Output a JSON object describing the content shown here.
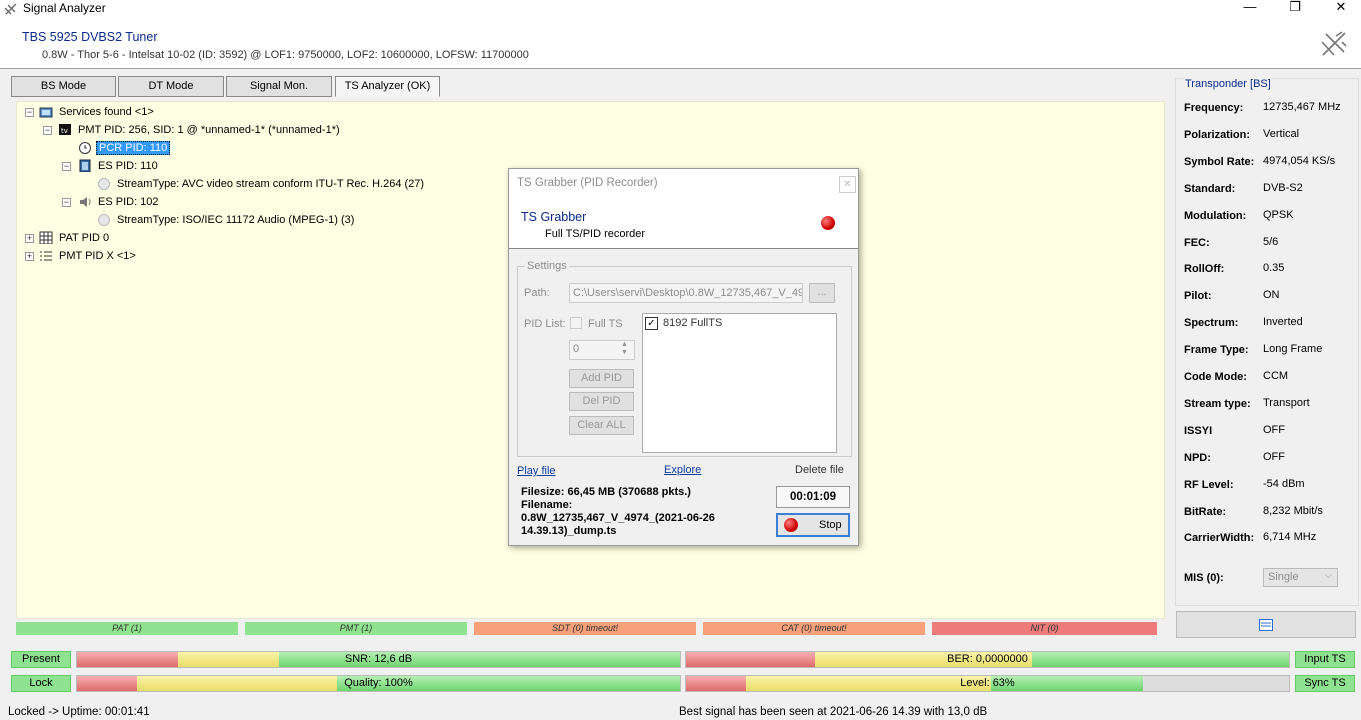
{
  "window": {
    "title": "Signal Analyzer",
    "min": "—",
    "max": "❐",
    "close": "✕"
  },
  "header": {
    "device": "TBS 5925 DVBS2 Tuner",
    "info": "0.8W - Thor 5-6 - Intelsat 10-02 (ID: 3592) @ LOF1: 9750000, LOF2: 10600000, LOFSW: 11700000"
  },
  "tabs": [
    "BS Mode",
    "DT Mode",
    "Signal Mon.",
    "TS Analyzer (OK)"
  ],
  "tree": {
    "services": "Services found <1>",
    "pmt": "PMT PID: 256, SID: 1 @ *unnamed-1* (*unnamed-1*)",
    "pcr": "PCR PID: 110",
    "es1": "ES PID: 110",
    "es1_type": "StreamType: AVC video stream conform ITU-T Rec. H.264 (27)",
    "es2": "ES PID: 102",
    "es2_type": "StreamType: ISO/IEC 11172 Audio (MPEG-1) (3)",
    "pat": "PAT PID 0",
    "pmtx": "PMT PID X <1>"
  },
  "dialog": {
    "title": "TS Grabber (PID Recorder)",
    "heading": "TS Grabber",
    "subheading": "Full TS/PID recorder",
    "settings": "Settings",
    "path_label": "Path:",
    "path_value": "C:\\Users\\servi\\Desktop\\0.8W_12735,467_V_49",
    "browse": "...",
    "pidlist_label": "PID List:",
    "fullts_label": "Full TS",
    "spin_value": "0",
    "add_pid": "Add PID",
    "del_pid": "Del PID",
    "clear_all": "Clear ALL",
    "list_item": "8192 FullTS",
    "play_file": "Play file",
    "explore": "Explore",
    "delete_file": "Delete file",
    "filesize": "Filesize: 66,45 MB (370688 pkts.)",
    "filename_label": "Filename:",
    "filename_line1": "0.8W_12735,467_V_4974_(2021-06-26",
    "filename_line2": "14.39.13)_dump.ts",
    "timer": "00:01:09",
    "stop": "Stop"
  },
  "transponder": {
    "title": "Transponder [BS]",
    "rows": [
      {
        "label": "Frequency:",
        "value": "12735,467 MHz"
      },
      {
        "label": "Polarization:",
        "value": "Vertical"
      },
      {
        "label": "Symbol Rate:",
        "value": "4974,054 KS/s"
      },
      {
        "label": "Standard:",
        "value": "DVB-S2"
      },
      {
        "label": "Modulation:",
        "value": "QPSK"
      },
      {
        "label": "FEC:",
        "value": "5/6"
      },
      {
        "label": "RollOff:",
        "value": "0.35"
      },
      {
        "label": "Pilot:",
        "value": "ON"
      },
      {
        "label": "Spectrum:",
        "value": "Inverted"
      },
      {
        "label": "Frame Type:",
        "value": "Long Frame"
      },
      {
        "label": "Code Mode:",
        "value": "CCM"
      },
      {
        "label": "Stream type:",
        "value": "Transport"
      },
      {
        "label": "ISSYI",
        "value": "OFF"
      },
      {
        "label": "NPD:",
        "value": "OFF"
      },
      {
        "label": "RF Level:",
        "value": "-54 dBm"
      },
      {
        "label": "BitRate:",
        "value": "8,232 Mbit/s"
      },
      {
        "label": "CarrierWidth:",
        "value": "6,714 MHz"
      }
    ],
    "mis_label": "MIS (0):",
    "mis_value": "Single"
  },
  "tables": [
    {
      "label": "PAT (1)",
      "color": "#8fe28f"
    },
    {
      "label": "PMT (1)",
      "color": "#8fe28f"
    },
    {
      "label": "SDT (0) timeout!",
      "color": "#f7a07a"
    },
    {
      "label": "CAT (0) timeout!",
      "color": "#f7a07a"
    },
    {
      "label": "NIT (0)",
      "color": "#ee7b7b"
    }
  ],
  "meters": {
    "present": "Present",
    "lock": "Lock",
    "snr": "SNR: 12,6 dB",
    "ber": "BER: 0,0000000",
    "quality": "Quality: 100%",
    "level": "Level: 63%",
    "level_fraction": 0.63,
    "input_ts": "Input TS",
    "sync_ts": "Sync TS"
  },
  "status": {
    "left": "Locked -> Uptime: 00:01:41",
    "center": "Best signal has been seen at 2021-06-26 14.39 with 13,0 dB"
  }
}
